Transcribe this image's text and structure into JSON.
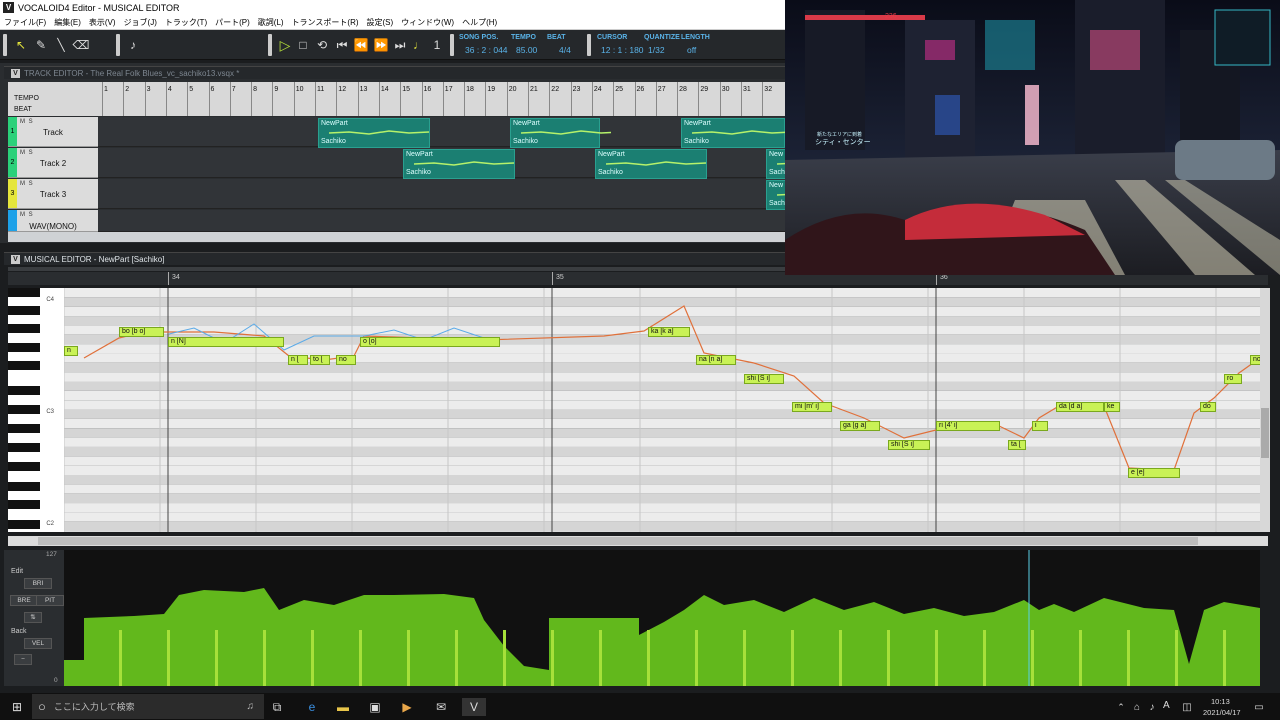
{
  "window": {
    "title": "VOCALOID4 Editor - MUSICAL EDITOR"
  },
  "menu": [
    "ファイル(F)",
    "編集(E)",
    "表示(V)",
    "ジョブ(J)",
    "トラック(T)",
    "パート(P)",
    "歌詞(L)",
    "トランスポート(R)",
    "設定(S)",
    "ウィンドウ(W)",
    "ヘルプ(H)"
  ],
  "transport": {
    "song_pos_label": "SONG POS.",
    "song_pos": "36 : 2 : 044",
    "tempo_label": "TEMPO",
    "tempo": "85.00",
    "beat_label": "BEAT",
    "beat": "4/4",
    "cursor_label": "CURSOR",
    "cursor": "12 : 1 : 180",
    "quantize_label": "QUANTIZE",
    "quantize": "1/32",
    "length_label": "LENGTH",
    "length": "off"
  },
  "track_editor": {
    "title": "TRACK EDITOR - The Real Folk Blues_vc_sachiko13.vsqx *",
    "tempo_label": "TEMPO",
    "beat_label": "BEAT",
    "measures": [
      "1",
      "2",
      "3",
      "4",
      "5",
      "6",
      "7",
      "8",
      "9",
      "10",
      "11",
      "12",
      "13",
      "14",
      "15",
      "16",
      "17",
      "18",
      "19",
      "20",
      "21",
      "22",
      "23",
      "24",
      "25",
      "26",
      "27",
      "28",
      "29",
      "30",
      "31",
      "32"
    ],
    "tracks": [
      {
        "num": "1",
        "name": "Track",
        "color": "#2bd17a"
      },
      {
        "num": "2",
        "name": "Track 2",
        "color": "#2bd17a"
      },
      {
        "num": "3",
        "name": "Track 3",
        "color": "#e5e63c"
      },
      {
        "num": "",
        "name": "WAV(MONO)",
        "color": "#1da1e8"
      }
    ],
    "parts": [
      {
        "track": 0,
        "name": "NewPart",
        "singer": "Sachiko"
      },
      {
        "track": 0,
        "name": "NewPart",
        "singer": "Sachiko"
      },
      {
        "track": 0,
        "name": "NewPart",
        "singer": "Sachiko"
      },
      {
        "track": 1,
        "name": "NewPart",
        "singer": "Sachiko"
      },
      {
        "track": 1,
        "name": "NewPart",
        "singer": "Sachiko"
      },
      {
        "track": 1,
        "name": "New",
        "singer": "Sachiko"
      },
      {
        "track": 2,
        "name": "New",
        "singer": "Sach"
      }
    ]
  },
  "musical_editor": {
    "title": "MUSICAL EDITOR - NewPart [Sachiko]",
    "measures": [
      "34",
      "35",
      "36"
    ],
    "octaves": [
      "C4",
      "C3",
      "C2"
    ],
    "notes": [
      {
        "lyric": "n",
        "row": 6
      },
      {
        "lyric": "bo [b o]",
        "row": 4
      },
      {
        "lyric": "n [N]",
        "row": 5
      },
      {
        "lyric": "n [",
        "row": 7
      },
      {
        "lyric": "to [",
        "row": 7
      },
      {
        "lyric": "no",
        "row": 7
      },
      {
        "lyric": "o [o]",
        "row": 5
      },
      {
        "lyric": "ka [k a]",
        "row": 4
      },
      {
        "lyric": "na [n a]",
        "row": 7
      },
      {
        "lyric": "shi [S i]",
        "row": 9
      },
      {
        "lyric": "mi [m' i]",
        "row": 12
      },
      {
        "lyric": "ga [g a]",
        "row": 14
      },
      {
        "lyric": "shi [S i]",
        "row": 16
      },
      {
        "lyric": "ri [4' i]",
        "row": 14
      },
      {
        "lyric": "ta [",
        "row": 16
      },
      {
        "lyric": "i",
        "row": 14
      },
      {
        "lyric": "da [d a]",
        "row": 12
      },
      {
        "lyric": "ke",
        "row": 12
      },
      {
        "lyric": "e [e]",
        "row": 19
      },
      {
        "lyric": "do",
        "row": 12
      },
      {
        "lyric": "ro",
        "row": 9
      },
      {
        "lyric": "no",
        "row": 7
      }
    ]
  },
  "control_track": {
    "max": "127",
    "min": "0",
    "edit_label": "Edit",
    "edit_param": "BRI",
    "btn_bre": "BRE",
    "btn_pit": "PIT",
    "back_label": "Back",
    "back_param": "VEL",
    "fill_color": "#62b81c"
  },
  "game_overlay": {
    "stat": "236",
    "location": "シティ・センター",
    "subloc": "新たなエリアに到着"
  },
  "taskbar": {
    "search_placeholder": "ここに入力して検索",
    "time": "10:13",
    "date": "2021/04/17",
    "ime": "A"
  }
}
